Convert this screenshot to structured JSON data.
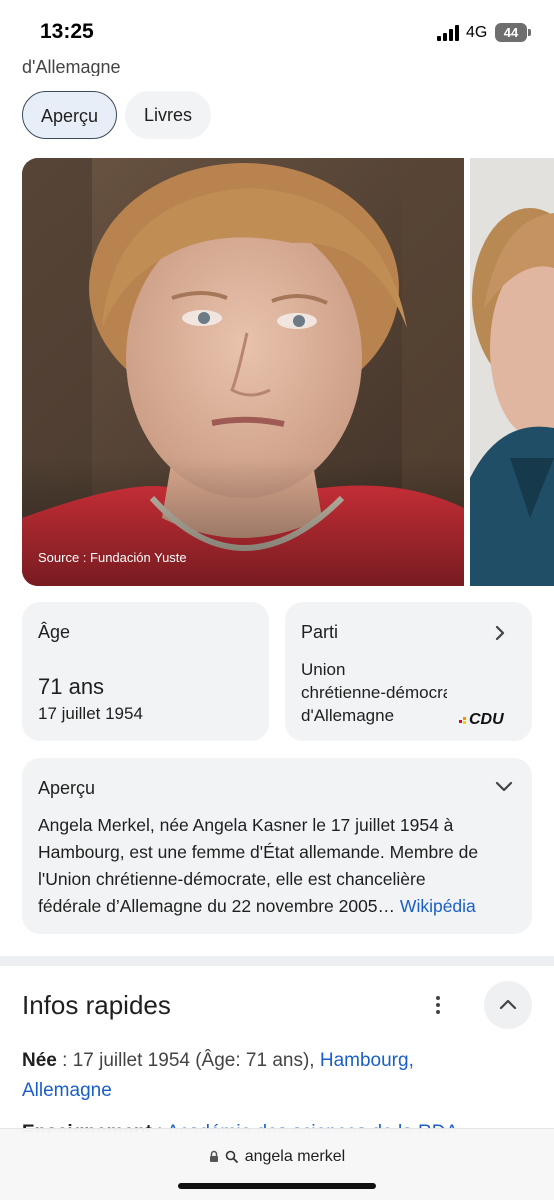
{
  "status_bar": {
    "time": "13:25",
    "network": "4G",
    "battery": "44"
  },
  "header": {
    "title_fragment": "d'Allemagne"
  },
  "chips": [
    {
      "label": "Aperçu",
      "active": true
    },
    {
      "label": "Livres",
      "active": false
    }
  ],
  "image": {
    "source": "Source : Fundación Yuste"
  },
  "age_card": {
    "label": "Âge",
    "value": "71 ans",
    "date": "17 juillet 1954"
  },
  "party_card": {
    "label": "Parti",
    "lines": [
      "Union",
      "chrétienne-démocrate",
      "d'Allemagne"
    ],
    "logo_text": "CDU"
  },
  "overview_card": {
    "label": "Aperçu",
    "lines": [
      "Angela Merkel, née Angela Kasner le 17 juillet 1954 à",
      "Hambourg, est une femme d'État allemande. Membre de",
      "l'Union chrétienne-démocrate, elle est chancelière"
    ],
    "last_line": "fédérale d’Allemagne du 22 novembre 2005",
    "ellipsis": "…",
    "source_link": "Wikipédia"
  },
  "quick_facts": {
    "title": "Infos rapides",
    "born_key": "Née",
    "born_value": " : 17 juillet 1954 (Âge: 71 ans), ",
    "born_place_1": "Hambourg,",
    "born_place_2": "Allemagne",
    "education_key": "Enseignement",
    "education_sep": " : ",
    "education_value": "Académie des sciences de la RDA"
  },
  "url_bar": {
    "query": "angela merkel"
  },
  "colors": {
    "link": "#1a5fc8",
    "chip_active_bg": "#e8eef7",
    "card_bg": "#f1f3f4"
  }
}
